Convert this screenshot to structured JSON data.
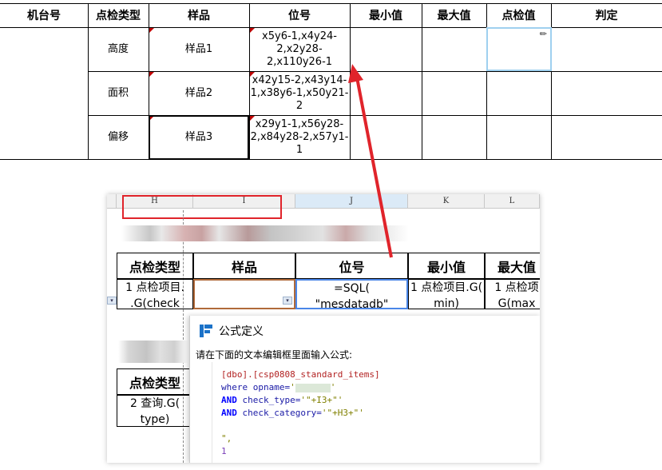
{
  "report": {
    "headers": [
      "机台号",
      "点检类型",
      "样品",
      "位号",
      "最小值",
      "最大值",
      "点检值",
      "判定"
    ],
    "rows": [
      {
        "type": "高度",
        "sample": "样品1",
        "position": [
          "x5y6-1,x4y24-",
          "2,x2y28-",
          "2,x110y26-1"
        ]
      },
      {
        "type": "面积",
        "sample": "样品2",
        "position": [
          "x42y15-2,x43y14-",
          "1,x38y6-1,x50y21-",
          "2"
        ]
      },
      {
        "type": "偏移",
        "sample": "样品3",
        "position": [
          "x29y1-1,x56y28-",
          "2,x84y28-2,x57y1-",
          "1"
        ]
      }
    ]
  },
  "sheet": {
    "columns": [
      "H",
      "I",
      "J",
      "K",
      "L"
    ],
    "active_column": "J",
    "headers": [
      "点检类型",
      "样品",
      "位号",
      "最小值",
      "最大值"
    ],
    "row1": [
      [
        "1 点检项目.",
        ".G(check"
      ],
      [
        "",
        ""
      ],
      [
        "=SQL(",
        "\"mesdatadb\""
      ],
      [
        "1 点检项目.G(",
        "min)"
      ],
      [
        "1 点检项",
        "G(max"
      ]
    ],
    "lower_header": "点检类型",
    "lower_cell": [
      "2 查询.G(",
      "type)"
    ]
  },
  "dialog": {
    "title": "公式定义",
    "prompt": "请在下面的文本编辑框里面输入公式:",
    "code": {
      "line1": "[dbo].[csp0808_standard_items]",
      "line2_kw": "where opname=",
      "line2_str_open": "'",
      "line2_str_close": "'",
      "line3_kw": "AND",
      "line3_text": " check_type=",
      "line3_str": "'\"+I3+\"'",
      "line4_kw": "AND",
      "line4_text": " check_category=",
      "line4_str": "'\"+H3+\"'",
      "line5": "\",",
      "line6": "1"
    }
  },
  "colors": {
    "arrow": "#e0242b",
    "selection": "#4a86e8",
    "redbox": "#e0242b"
  }
}
